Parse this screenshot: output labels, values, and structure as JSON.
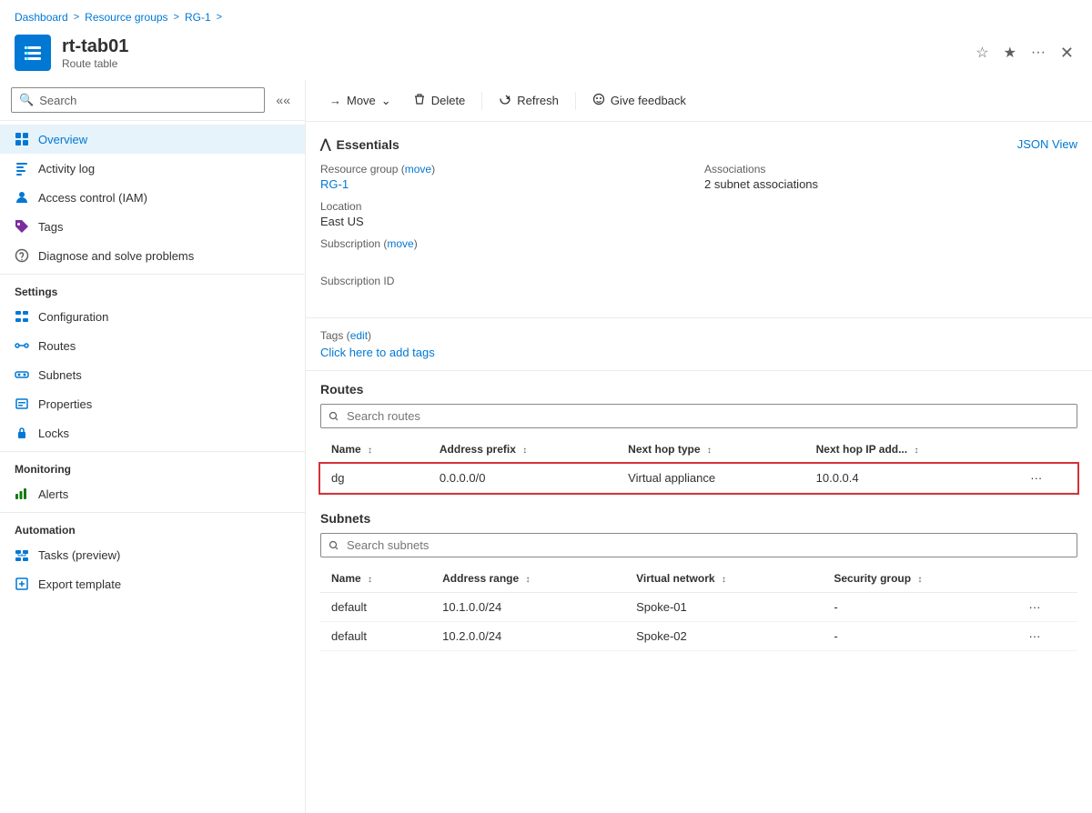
{
  "breadcrumb": {
    "items": [
      "Dashboard",
      "Resource groups",
      "RG-1"
    ],
    "separators": [
      ">",
      ">",
      ">"
    ]
  },
  "resource": {
    "name": "rt-tab01",
    "subtitle": "Route table"
  },
  "header_buttons": {
    "favorite": "☆",
    "share": "★",
    "more": "···",
    "close": "✕"
  },
  "search": {
    "placeholder": "Search"
  },
  "sidebar": {
    "nav_items": [
      {
        "id": "overview",
        "label": "Overview",
        "active": true,
        "icon": "overview"
      },
      {
        "id": "activity-log",
        "label": "Activity log",
        "active": false,
        "icon": "activity"
      },
      {
        "id": "access-control",
        "label": "Access control (IAM)",
        "active": false,
        "icon": "access"
      },
      {
        "id": "tags",
        "label": "Tags",
        "active": false,
        "icon": "tags"
      },
      {
        "id": "diagnose",
        "label": "Diagnose and solve problems",
        "active": false,
        "icon": "diagnose"
      }
    ],
    "settings_section": "Settings",
    "settings_items": [
      {
        "id": "configuration",
        "label": "Configuration",
        "icon": "config"
      },
      {
        "id": "routes",
        "label": "Routes",
        "icon": "routes"
      },
      {
        "id": "subnets",
        "label": "Subnets",
        "icon": "subnets"
      },
      {
        "id": "properties",
        "label": "Properties",
        "icon": "properties"
      },
      {
        "id": "locks",
        "label": "Locks",
        "icon": "locks"
      }
    ],
    "monitoring_section": "Monitoring",
    "monitoring_items": [
      {
        "id": "alerts",
        "label": "Alerts",
        "icon": "alerts"
      }
    ],
    "automation_section": "Automation",
    "automation_items": [
      {
        "id": "tasks",
        "label": "Tasks (preview)",
        "icon": "tasks"
      },
      {
        "id": "export",
        "label": "Export template",
        "icon": "export"
      }
    ]
  },
  "toolbar": {
    "move_label": "Move",
    "delete_label": "Delete",
    "refresh_label": "Refresh",
    "feedback_label": "Give feedback"
  },
  "essentials": {
    "title": "Essentials",
    "json_view": "JSON View",
    "fields": [
      {
        "label": "Resource group (move)",
        "value": "RG-1",
        "is_link": true
      },
      {
        "label": "Associations",
        "value": "2 subnet associations",
        "is_link": false
      },
      {
        "label": "Location",
        "value": "East US",
        "is_link": false
      },
      {
        "label": "",
        "value": "",
        "is_link": false
      },
      {
        "label": "Subscription (move)",
        "value": "",
        "is_link": false
      },
      {
        "label": "",
        "value": "",
        "is_link": false
      },
      {
        "label": "Subscription ID",
        "value": "",
        "is_link": false
      },
      {
        "label": "",
        "value": "",
        "is_link": false
      }
    ]
  },
  "tags": {
    "label": "Tags (edit)",
    "add_link": "Click here to add tags"
  },
  "routes": {
    "section_title": "Routes",
    "search_placeholder": "Search routes",
    "columns": [
      "Name",
      "Address prefix",
      "Next hop type",
      "Next hop IP add..."
    ],
    "rows": [
      {
        "name": "dg",
        "address_prefix": "0.0.0.0/0",
        "next_hop_type": "Virtual appliance",
        "next_hop_ip": "10.0.0.4",
        "highlighted": true
      }
    ]
  },
  "subnets": {
    "section_title": "Subnets",
    "search_placeholder": "Search subnets",
    "columns": [
      "Name",
      "Address range",
      "Virtual network",
      "Security group"
    ],
    "rows": [
      {
        "name": "default",
        "address_range": "10.1.0.0/24",
        "virtual_network": "Spoke-01",
        "security_group": "-"
      },
      {
        "name": "default",
        "address_range": "10.2.0.0/24",
        "virtual_network": "Spoke-02",
        "security_group": "-"
      }
    ]
  }
}
